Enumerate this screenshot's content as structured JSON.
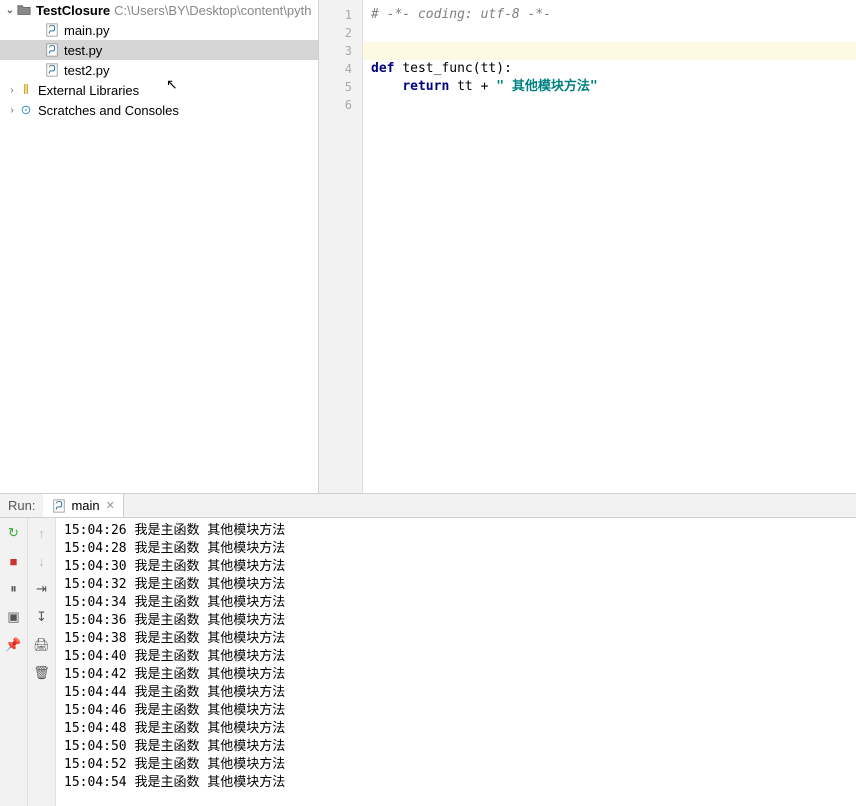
{
  "tree": {
    "root_name": "TestClosure",
    "root_path": "C:\\Users\\BY\\Desktop\\content\\pyth",
    "files": [
      {
        "name": "main.py"
      },
      {
        "name": "test.py",
        "selected": true
      },
      {
        "name": "test2.py"
      }
    ],
    "external": "External Libraries",
    "scratches": "Scratches and Consoles"
  },
  "editor": {
    "lines": [
      {
        "n": "1",
        "segs": [
          {
            "t": "# -*- coding: utf-8 -*-",
            "c": "c-comment"
          }
        ]
      },
      {
        "n": "2",
        "segs": []
      },
      {
        "n": "3",
        "segs": [],
        "hl": true
      },
      {
        "n": "4",
        "segs": [
          {
            "t": "def ",
            "c": "c-keyword"
          },
          {
            "t": "test_func",
            "c": "c-func"
          },
          {
            "t": "(tt):",
            "c": "c-punct"
          }
        ]
      },
      {
        "n": "5",
        "segs": [
          {
            "t": "    ",
            "c": ""
          },
          {
            "t": "return ",
            "c": "c-keyword"
          },
          {
            "t": "tt + ",
            "c": "c-punct"
          },
          {
            "t": "\" 其他模块方法\"",
            "c": "c-string"
          }
        ]
      },
      {
        "n": "6",
        "segs": []
      }
    ]
  },
  "run": {
    "label": "Run:",
    "tab": "main",
    "output": [
      {
        "ts": "15:04:26",
        "msg": "我是主函数 其他模块方法"
      },
      {
        "ts": "15:04:28",
        "msg": "我是主函数 其他模块方法"
      },
      {
        "ts": "15:04:30",
        "msg": "我是主函数 其他模块方法"
      },
      {
        "ts": "15:04:32",
        "msg": "我是主函数 其他模块方法"
      },
      {
        "ts": "15:04:34",
        "msg": "我是主函数 其他模块方法"
      },
      {
        "ts": "15:04:36",
        "msg": "我是主函数 其他模块方法"
      },
      {
        "ts": "15:04:38",
        "msg": "我是主函数 其他模块方法"
      },
      {
        "ts": "15:04:40",
        "msg": "我是主函数 其他模块方法"
      },
      {
        "ts": "15:04:42",
        "msg": "我是主函数 其他模块方法"
      },
      {
        "ts": "15:04:44",
        "msg": "我是主函数 其他模块方法"
      },
      {
        "ts": "15:04:46",
        "msg": "我是主函数 其他模块方法"
      },
      {
        "ts": "15:04:48",
        "msg": "我是主函数 其他模块方法"
      },
      {
        "ts": "15:04:50",
        "msg": "我是主函数 其他模块方法"
      },
      {
        "ts": "15:04:52",
        "msg": "我是主函数 其他模块方法"
      },
      {
        "ts": "15:04:54",
        "msg": "我是主函数 其他模块方法"
      }
    ]
  }
}
